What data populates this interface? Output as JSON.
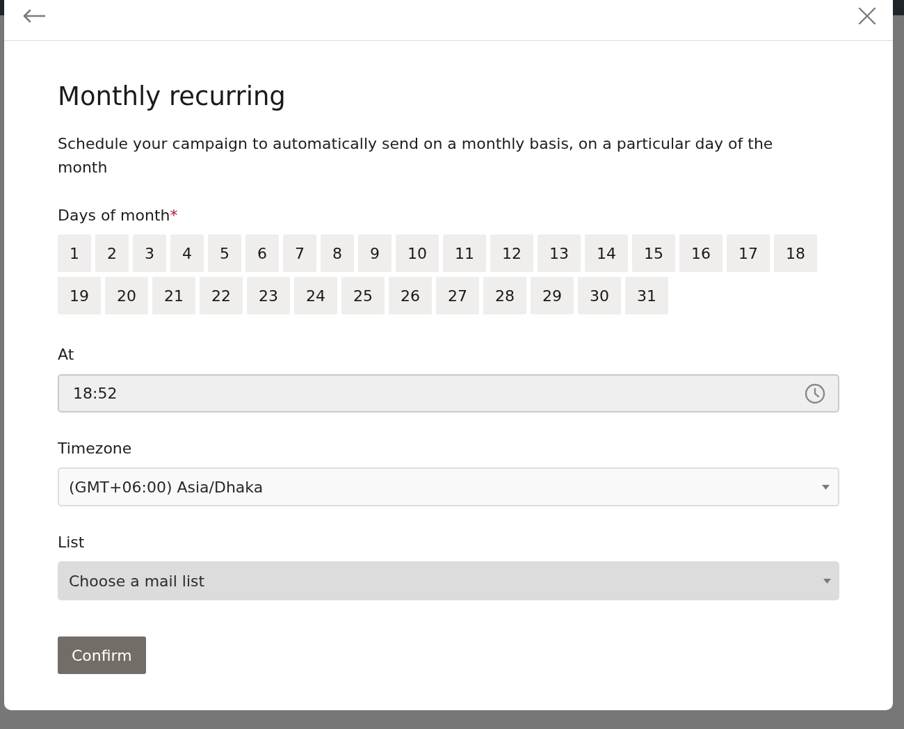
{
  "title": "Monthly recurring",
  "description": "Schedule your campaign to automatically send on a monthly basis, on a particular day of the month",
  "days_field": {
    "label": "Days of month",
    "required_mark": "*",
    "days": [
      {
        "label": "1",
        "selected": false
      },
      {
        "label": "2",
        "selected": false
      },
      {
        "label": "3",
        "selected": false
      },
      {
        "label": "4",
        "selected": false
      },
      {
        "label": "5",
        "selected": false
      },
      {
        "label": "6",
        "selected": false
      },
      {
        "label": "7",
        "selected": false
      },
      {
        "label": "8",
        "selected": false
      },
      {
        "label": "9",
        "selected": false
      },
      {
        "label": "10",
        "selected": false
      },
      {
        "label": "11",
        "selected": false
      },
      {
        "label": "12",
        "selected": false
      },
      {
        "label": "13",
        "selected": false
      },
      {
        "label": "14",
        "selected": false
      },
      {
        "label": "15",
        "selected": false
      },
      {
        "label": "16",
        "selected": false
      },
      {
        "label": "17",
        "selected": false
      },
      {
        "label": "18",
        "selected": false
      },
      {
        "label": "19",
        "selected": false
      },
      {
        "label": "20",
        "selected": false
      },
      {
        "label": "21",
        "selected": false
      },
      {
        "label": "22",
        "selected": false
      },
      {
        "label": "23",
        "selected": false
      },
      {
        "label": "24",
        "selected": false
      },
      {
        "label": "25",
        "selected": false
      },
      {
        "label": "26",
        "selected": false
      },
      {
        "label": "27",
        "selected": false
      },
      {
        "label": "28",
        "selected": false
      },
      {
        "label": "29",
        "selected": false
      },
      {
        "label": "30",
        "selected": false
      },
      {
        "label": "31",
        "selected": false
      }
    ]
  },
  "time_field": {
    "label": "At",
    "value": "18:52"
  },
  "timezone_field": {
    "label": "Timezone",
    "value": "(GMT+06:00) Asia/Dhaka"
  },
  "list_field": {
    "label": "List",
    "placeholder": "Choose a mail list"
  },
  "confirm_button": {
    "label": "Confirm"
  }
}
